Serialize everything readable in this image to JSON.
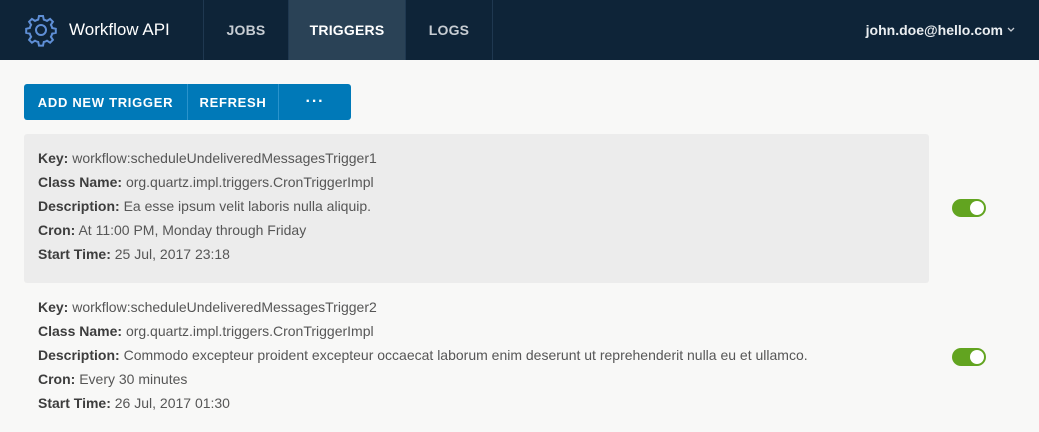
{
  "header": {
    "app_title": "Workflow API",
    "logo_icon": "gear-icon",
    "tabs": [
      {
        "label": "JOBS",
        "active": false
      },
      {
        "label": "TRIGGERS",
        "active": true
      },
      {
        "label": "LOGS",
        "active": false
      }
    ],
    "user": "john.doe@hello.com",
    "user_caret_icon": "chevron-down-icon"
  },
  "colors": {
    "header_bg": "#0e2438",
    "active_tab_bg": "#2a4256",
    "button_bg": "#0079b8",
    "toggle_on": "#62a420"
  },
  "toolbar": {
    "add_label": "ADD NEW TRIGGER",
    "refresh_label": "REFRESH",
    "more_label": "···"
  },
  "labels": {
    "key": "Key:",
    "class_name": "Class Name:",
    "description": "Description:",
    "cron": "Cron:",
    "start_time": "Start Time:"
  },
  "triggers": [
    {
      "key": "workflow:scheduleUndeliveredMessagesTrigger1",
      "class_name": "org.quartz.impl.triggers.CronTriggerImpl",
      "description": "Ea esse ipsum velit laboris nulla aliquip.",
      "cron": "At 11:00 PM, Monday through Friday",
      "start_time": "25 Jul, 2017 23:18",
      "enabled": true
    },
    {
      "key": "workflow:scheduleUndeliveredMessagesTrigger2",
      "class_name": "org.quartz.impl.triggers.CronTriggerImpl",
      "description": "Commodo excepteur proident excepteur occaecat laborum enim deserunt ut reprehenderit nulla eu et ullamco.",
      "cron": "Every 30 minutes",
      "start_time": "26 Jul, 2017 01:30",
      "enabled": true
    }
  ]
}
